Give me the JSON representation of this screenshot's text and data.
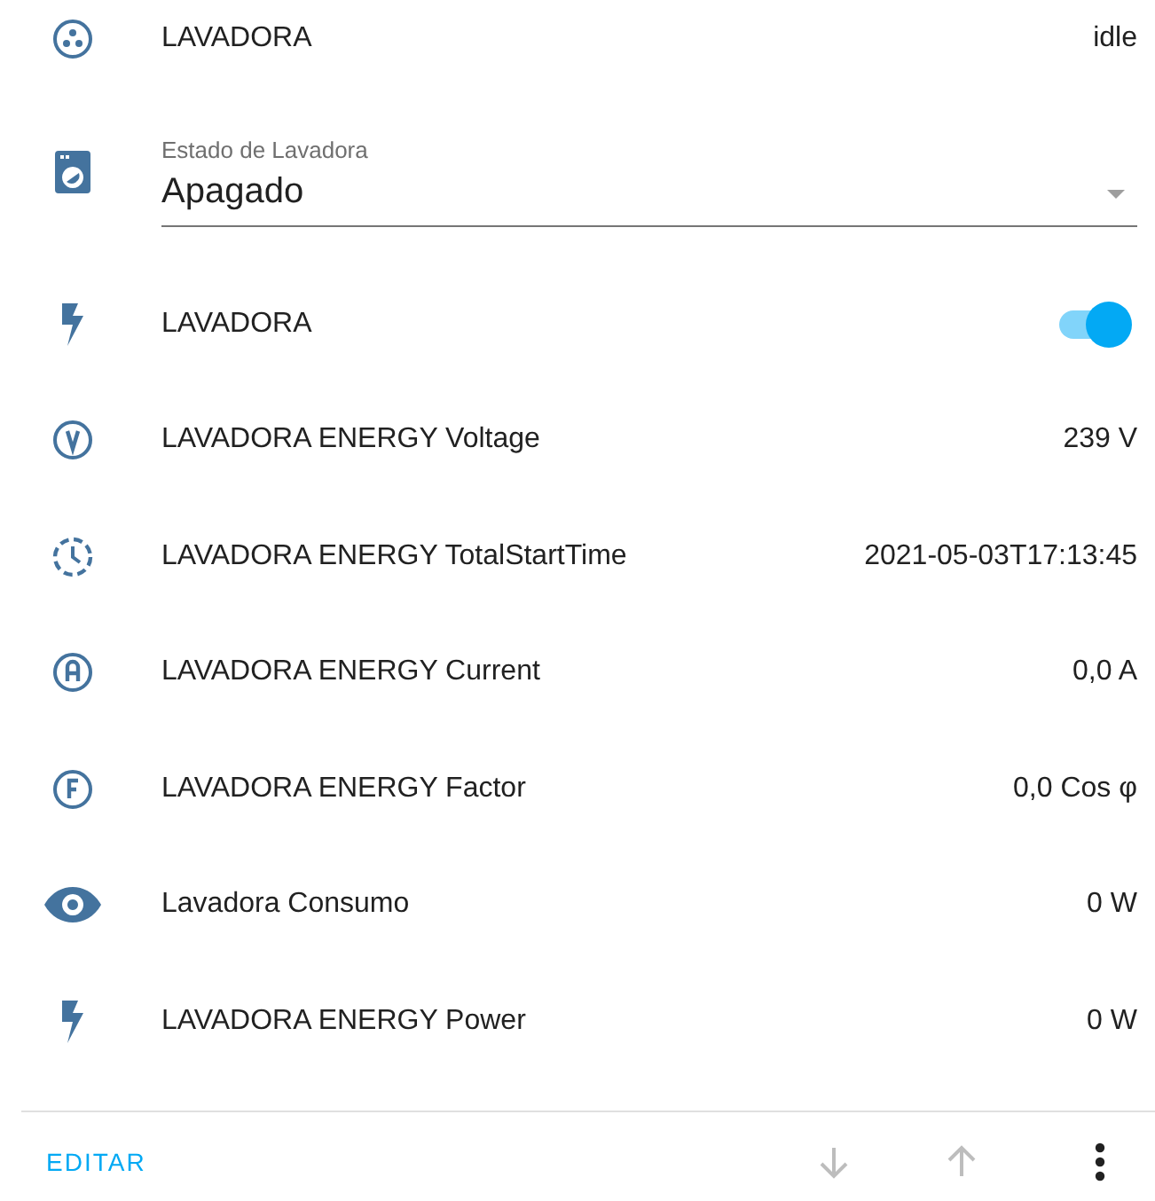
{
  "rows": [
    {
      "kind": "state",
      "name": "LAVADORA",
      "value": "idle"
    },
    {
      "kind": "select",
      "label": "Estado de Lavadora",
      "value": "Apagado"
    },
    {
      "kind": "toggle",
      "name": "LAVADORA",
      "on": true
    },
    {
      "kind": "state",
      "name": "LAVADORA ENERGY Voltage",
      "value": "239 V"
    },
    {
      "kind": "state",
      "name": "LAVADORA ENERGY TotalStartTime",
      "value": "2021-05-03T17:13:45"
    },
    {
      "kind": "state",
      "name": "LAVADORA ENERGY Current",
      "value": "0,0 A"
    },
    {
      "kind": "state",
      "name": "LAVADORA ENERGY Factor",
      "value": "0,0 Cos φ"
    },
    {
      "kind": "state",
      "name": "Lavadora Consumo",
      "value": "0 W"
    },
    {
      "kind": "state",
      "name": "LAVADORA ENERGY Power",
      "value": "0 W"
    }
  ],
  "footer": {
    "edit_button": "EDITAR",
    "move_down": {
      "disabled": true
    },
    "move_up": {
      "disabled": true
    }
  }
}
